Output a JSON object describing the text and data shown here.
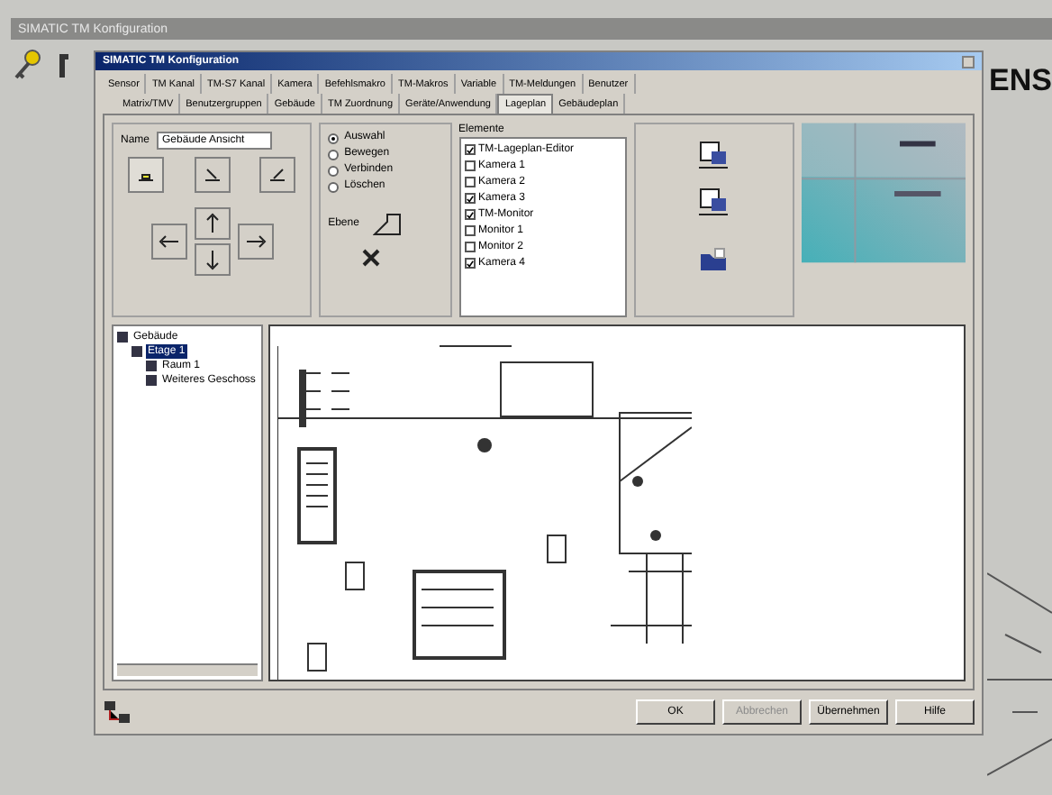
{
  "app": {
    "title": "SIMATIC TM Konfiguration",
    "logo": "ENS"
  },
  "dialog": {
    "title": "SIMATIC TM Konfiguration"
  },
  "tabs_row_1": [
    {
      "label": "Sensor",
      "selected": false
    },
    {
      "label": "TM Kanal",
      "selected": false
    },
    {
      "label": "TM-S7 Kanal",
      "selected": false
    },
    {
      "label": "Kamera",
      "selected": false
    },
    {
      "label": "Befehlsmakro",
      "selected": false
    },
    {
      "label": "TM-Makros",
      "selected": false
    },
    {
      "label": "Variable",
      "selected": false
    },
    {
      "label": "TM-Meldungen",
      "selected": false
    },
    {
      "label": "Benutzer",
      "selected": false
    }
  ],
  "tabs_row_2": [
    {
      "label": "Matrix/TMV",
      "selected": false
    },
    {
      "label": "Benutzergruppen",
      "selected": false
    },
    {
      "label": "Gebäude",
      "selected": false
    },
    {
      "label": "TM Zuordnung",
      "selected": false
    },
    {
      "label": "Geräte/Anwendung",
      "selected": false
    },
    {
      "label": "Lageplan",
      "selected": true
    },
    {
      "label": "Gebäudeplan",
      "selected": false
    }
  ],
  "name_field": {
    "label": "Name",
    "value": "Gebäude Ansicht"
  },
  "mode_radios": [
    {
      "label": "Auswahl",
      "selected": true
    },
    {
      "label": "Bewegen",
      "selected": false
    },
    {
      "label": "Verbinden",
      "selected": false
    },
    {
      "label": "Löschen",
      "selected": false
    }
  ],
  "layer_label": "Ebene",
  "elements_list": {
    "title": "Elemente",
    "items": [
      {
        "label": "TM-Lageplan-Editor",
        "checked": true
      },
      {
        "label": "Kamera 1",
        "checked": false
      },
      {
        "label": "Kamera 2",
        "checked": false
      },
      {
        "label": "Kamera 3",
        "checked": true
      },
      {
        "label": "TM-Monitor",
        "checked": true
      },
      {
        "label": "Monitor 1",
        "checked": false
      },
      {
        "label": "Monitor 2",
        "checked": false
      },
      {
        "label": "Kamera 4",
        "checked": true
      }
    ]
  },
  "tree": [
    {
      "label": "Gebäude",
      "selected": false,
      "children": [
        {
          "label": "Etage 1",
          "selected": true,
          "children": [
            {
              "label": "Raum 1",
              "selected": false
            },
            {
              "label": "Weiteres Geschoss",
              "selected": false
            }
          ]
        }
      ]
    }
  ],
  "buttons": [
    {
      "label": "OK",
      "disabled": false
    },
    {
      "label": "Abbrechen",
      "disabled": true
    },
    {
      "label": "Übernehmen",
      "disabled": false
    },
    {
      "label": "Hilfe",
      "disabled": false
    }
  ]
}
